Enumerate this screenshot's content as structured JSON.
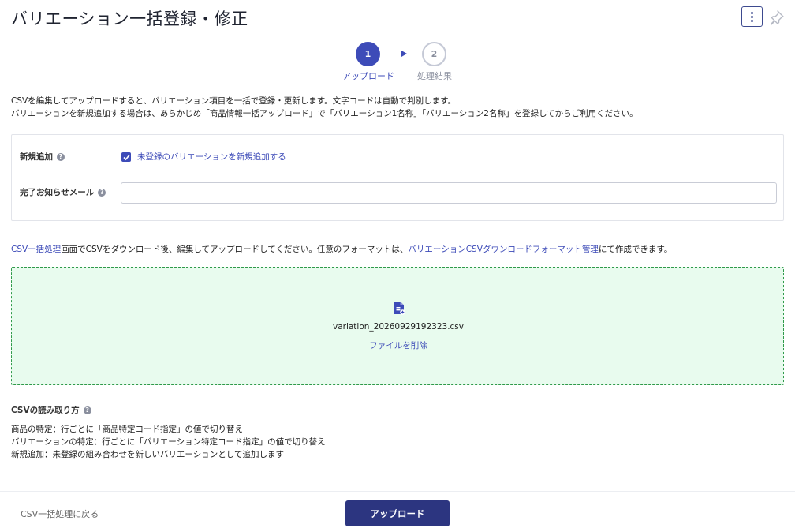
{
  "page": {
    "title": "バリエーション一括登録・修正"
  },
  "header": {
    "menu_icon": "more-vertical-icon",
    "pin_icon": "pin-icon"
  },
  "stepper": {
    "steps": [
      {
        "number": "1",
        "label": "アップロード",
        "active": true
      },
      {
        "number": "2",
        "label": "処理結果",
        "active": false
      }
    ]
  },
  "intro": {
    "line1": "CSVを編集してアップロードすると、バリエーション項目を一括で登録・更新します。文字コードは自動で判別します。",
    "line2": "バリエーションを新規追加する場合は、あらかじめ「商品情報一括アップロード」で「バリエーション1名称」「バリエーション2名称」を登録してからご利用ください。"
  },
  "form": {
    "new_add_label": "新規追加",
    "new_add_checkbox_label": "未登録のバリエーションを新規追加する",
    "new_add_checked": true,
    "mail_label": "完了お知らせメール",
    "mail_value": ""
  },
  "csv_note": {
    "link1": "CSV一括処理",
    "text1": "画面でCSVをダウンロード後、編集してアップロードしてください。任意のフォーマットは、",
    "link2": "バリエーションCSVダウンロードフォーマット管理",
    "text2": "にて作成できます。"
  },
  "dropzone": {
    "file_icon": "file-plus-icon",
    "file_name": "variation_20260929192323.csv",
    "delete_label": "ファイルを削除"
  },
  "read_guide": {
    "title": "CSVの読み取り方",
    "line1": "商品の特定：行ごとに「商品特定コード指定」の値で切り替え",
    "line2": "バリエーションの特定：行ごとに「バリエーション特定コード指定」の値で切り替え",
    "line3": "新規追加：未登録の組み合わせを新しいバリエーションとして追加します"
  },
  "footer": {
    "back_label": "CSV一括処理に戻る",
    "upload_label": "アップロード"
  },
  "colors": {
    "primary": "#3d4bb8",
    "button": "#2c3580",
    "drop_bg": "#e8fbee",
    "drop_border": "#2f9a4a"
  }
}
